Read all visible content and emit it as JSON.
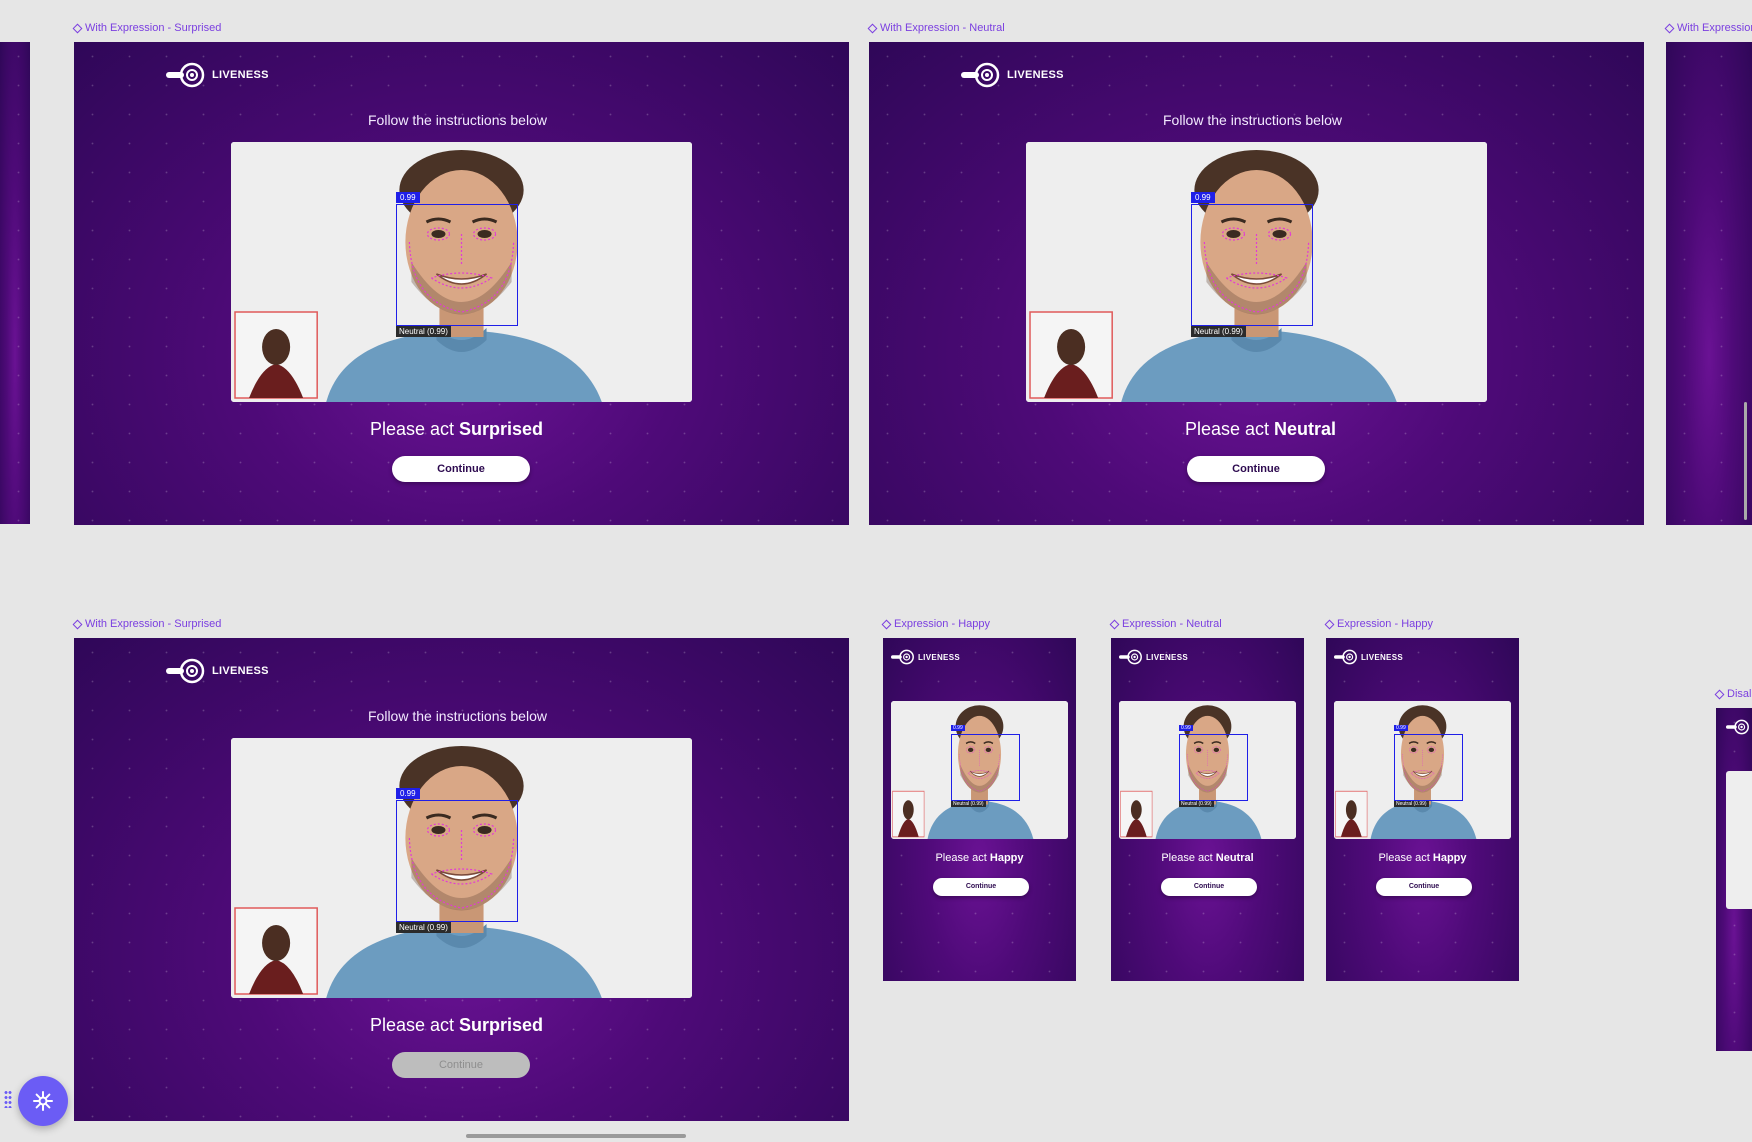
{
  "brand": {
    "name": "LIVENESS"
  },
  "instruction": "Follow the instructions below",
  "prompt_prefix": "Please act",
  "face_score": "0.99",
  "face_label": "Neutral (0.99)",
  "frames": [
    {
      "label": "With Expression - Surprised",
      "expression": "Surprised",
      "button": "Continue",
      "button_state": "enabled"
    },
    {
      "label": "With Expression - Neutral",
      "expression": "Neutral",
      "button": "Continue",
      "button_state": "enabled"
    },
    {
      "label": "With Expression",
      "expression": "",
      "button": "",
      "button_state": "partial"
    },
    {
      "label": "With Expression - Surprised",
      "expression": "Surprised",
      "button": "Continue",
      "button_state": "disabled"
    },
    {
      "label": "Expression - Happy",
      "expression": "Happy",
      "button": "Continue",
      "button_state": "enabled"
    },
    {
      "label": "Expression - Neutral",
      "expression": "Neutral",
      "button": "Continue",
      "button_state": "enabled"
    },
    {
      "label": "Expression - Happy",
      "expression": "Happy",
      "button": "Continue",
      "button_state": "enabled"
    },
    {
      "label": "Disal",
      "expression": "",
      "button": "",
      "button_state": "partial"
    }
  ],
  "colors": {
    "canvas": "#e6e6e6",
    "frame_dark": "#2f0758",
    "frame_mid": "#6a1294",
    "accent": "#7b3fe0",
    "face_box": "#1f1fe8",
    "fab": "#6b5cf5"
  },
  "icons": {
    "fab": "snowflake-icon",
    "component": "diamond-icon",
    "logo": "liveness-logo-icon"
  }
}
